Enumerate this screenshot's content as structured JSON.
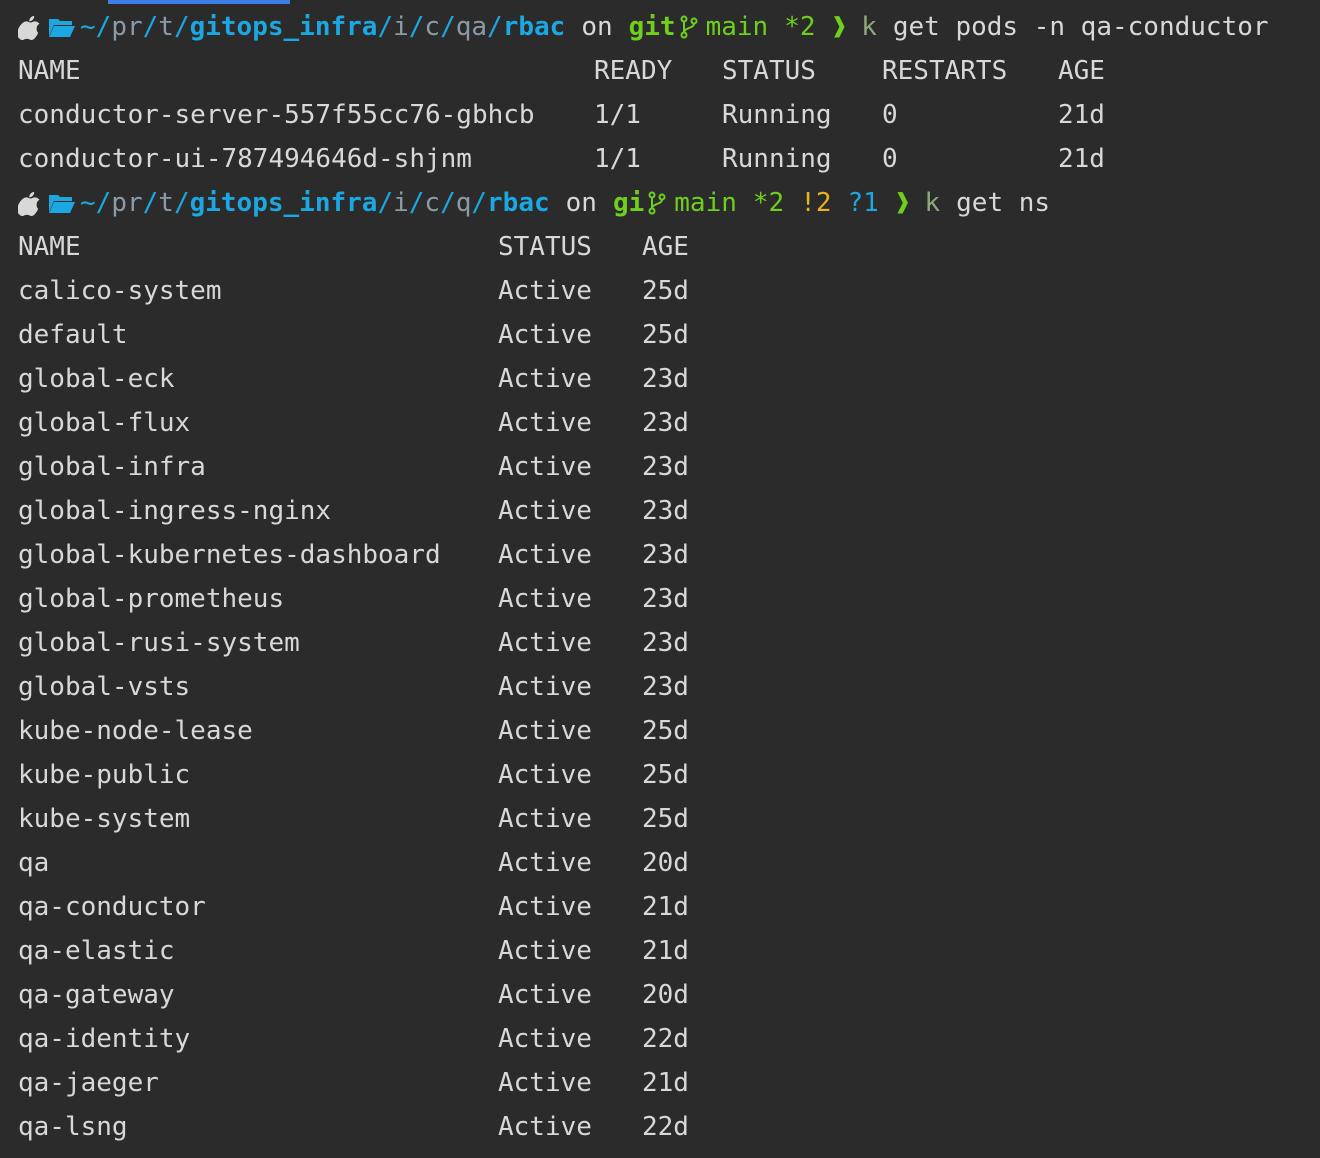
{
  "colors": {
    "background": "#2b2b2b",
    "text": "#d8d8d8",
    "path": "#1ba8e0",
    "git": "#6ed01c",
    "warning": "#e6b41e"
  },
  "prompt1": {
    "path": {
      "tilde": "~",
      "s1": "/",
      "pr": "pr",
      "s2": "/",
      "t": "t",
      "s3": "/",
      "repo": "gitops_infra",
      "s4": "/",
      "i": "i",
      "s5": "/",
      "c": "c",
      "s6": "/",
      "q": "qa",
      "s7": "/",
      "leaf": "rbac"
    },
    "on": "on",
    "git_label": "git",
    "branch": "main",
    "status": "*2",
    "arrow": "❱",
    "cmd_k": "k",
    "command": "get pods -n qa-conductor"
  },
  "pods_table": {
    "headers": {
      "name": "NAME",
      "ready": "READY",
      "status": "STATUS",
      "restarts": "RESTARTS",
      "age": "AGE"
    },
    "rows": [
      {
        "name": "conductor-server-557f55cc76-gbhcb",
        "ready": "1/1",
        "status": "Running",
        "restarts": "0",
        "age": "21d"
      },
      {
        "name": "conductor-ui-787494646d-shjnm",
        "ready": "1/1",
        "status": "Running",
        "restarts": "0",
        "age": "21d"
      }
    ]
  },
  "prompt2": {
    "path": {
      "tilde": "~",
      "s1": "/",
      "pr": "pr",
      "s2": "/",
      "t": "t",
      "s3": "/",
      "repo": "gitops_infra",
      "s4": "/",
      "i": "i",
      "s5": "/",
      "c": "c",
      "s6": "/",
      "q": "q",
      "s7": "/",
      "leaf": "rbac"
    },
    "on": "on",
    "git_label": "gi",
    "branch": "main",
    "status": "*2",
    "modified": "!2",
    "untracked": "?1",
    "arrow": "❱",
    "cmd_k": "k",
    "command": "get ns"
  },
  "ns_table": {
    "headers": {
      "name": "NAME",
      "status": "STATUS",
      "age": "AGE"
    },
    "rows": [
      {
        "name": "calico-system",
        "status": "Active",
        "age": "25d"
      },
      {
        "name": "default",
        "status": "Active",
        "age": "25d"
      },
      {
        "name": "global-eck",
        "status": "Active",
        "age": "23d"
      },
      {
        "name": "global-flux",
        "status": "Active",
        "age": "23d"
      },
      {
        "name": "global-infra",
        "status": "Active",
        "age": "23d"
      },
      {
        "name": "global-ingress-nginx",
        "status": "Active",
        "age": "23d"
      },
      {
        "name": "global-kubernetes-dashboard",
        "status": "Active",
        "age": "23d"
      },
      {
        "name": "global-prometheus",
        "status": "Active",
        "age": "23d"
      },
      {
        "name": "global-rusi-system",
        "status": "Active",
        "age": "23d"
      },
      {
        "name": "global-vsts",
        "status": "Active",
        "age": "23d"
      },
      {
        "name": "kube-node-lease",
        "status": "Active",
        "age": "25d"
      },
      {
        "name": "kube-public",
        "status": "Active",
        "age": "25d"
      },
      {
        "name": "kube-system",
        "status": "Active",
        "age": "25d"
      },
      {
        "name": "qa",
        "status": "Active",
        "age": "20d"
      },
      {
        "name": "qa-conductor",
        "status": "Active",
        "age": "21d"
      },
      {
        "name": "qa-elastic",
        "status": "Active",
        "age": "21d"
      },
      {
        "name": "qa-gateway",
        "status": "Active",
        "age": "20d"
      },
      {
        "name": "qa-identity",
        "status": "Active",
        "age": "22d"
      },
      {
        "name": "qa-jaeger",
        "status": "Active",
        "age": "21d"
      },
      {
        "name": "qa-lsng",
        "status": "Active",
        "age": "22d"
      }
    ]
  }
}
